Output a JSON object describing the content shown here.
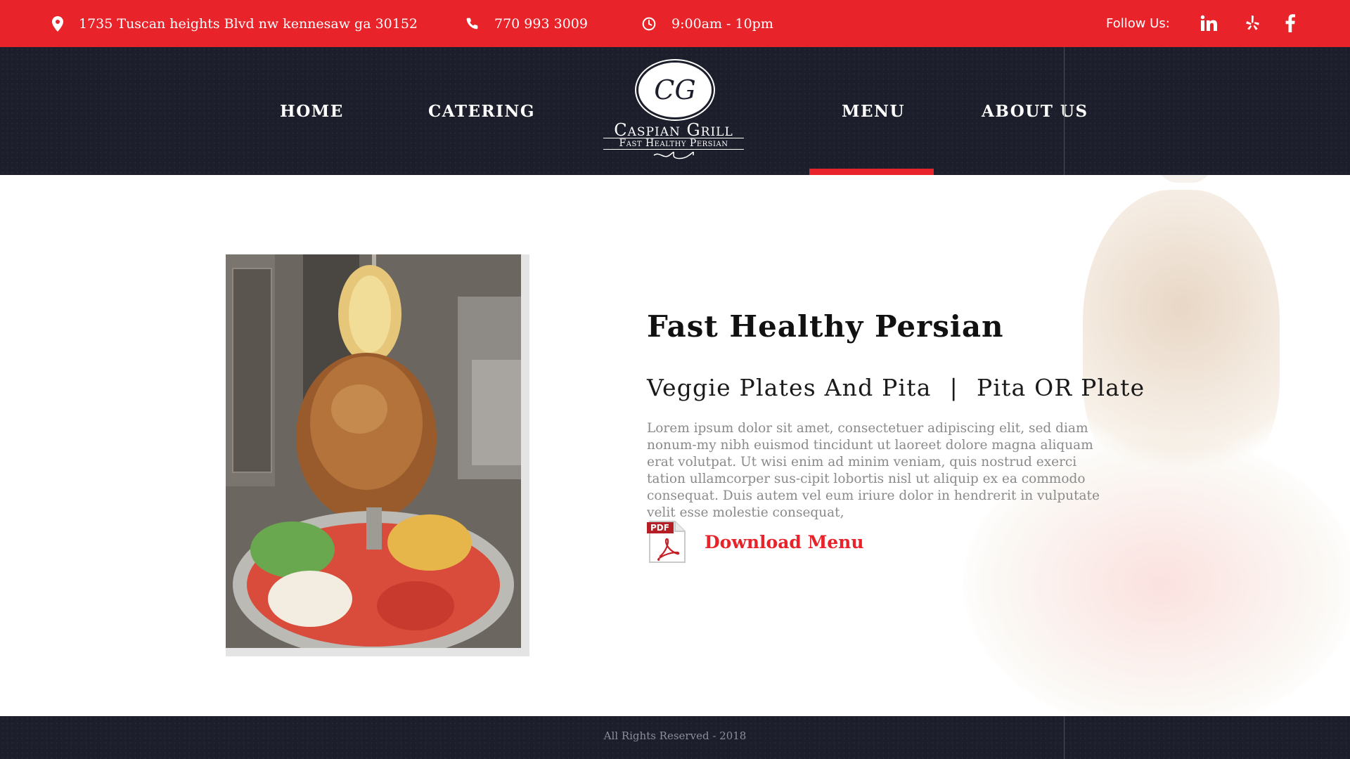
{
  "topbar": {
    "address": "1735 Tuscan heights Blvd nw kennesaw ga 30152",
    "phone": "770 993 3009",
    "hours": "9:00am - 10pm",
    "follow_label": "Follow Us:",
    "address_icon": "map-pin-icon",
    "phone_icon": "phone-icon",
    "hours_icon": "clock-icon",
    "social": [
      "linkedin-icon",
      "yelp-icon",
      "facebook-icon"
    ]
  },
  "nav": {
    "items": [
      {
        "label": "HOME"
      },
      {
        "label": "CATERING"
      },
      {
        "label": "MENU"
      },
      {
        "label": "ABOUT US"
      }
    ],
    "active": "MENU"
  },
  "logo": {
    "monogram": "CG",
    "name": "Caspian Grill",
    "tagline": "Fast Healthy Persian"
  },
  "main": {
    "headline": "Fast Healthy Persian",
    "subline_left": "Veggie Plates And Pita",
    "subline_sep": "|",
    "subline_right": "Pita OR Plate",
    "body": "Lorem ipsum dolor sit amet, consectetuer adipiscing elit, sed diam nonum-my nibh euismod tincidunt ut laoreet dolore magna aliquam erat volutpat. Ut wisi enim ad minim veniam, quis nostrud exerci tation ullamcorper sus-cipit lobortis nisl ut aliquip ex ea commodo consequat. Duis autem vel eum iriure dolor in hendrerit in vulputate velit esse molestie consequat,",
    "download_label": "Download Menu",
    "pdf_badge": "PDF"
  },
  "footer": {
    "text": "All Rights Reserved - 2018"
  },
  "colors": {
    "accent": "#e8232a",
    "dark": "#1c1f2b"
  }
}
